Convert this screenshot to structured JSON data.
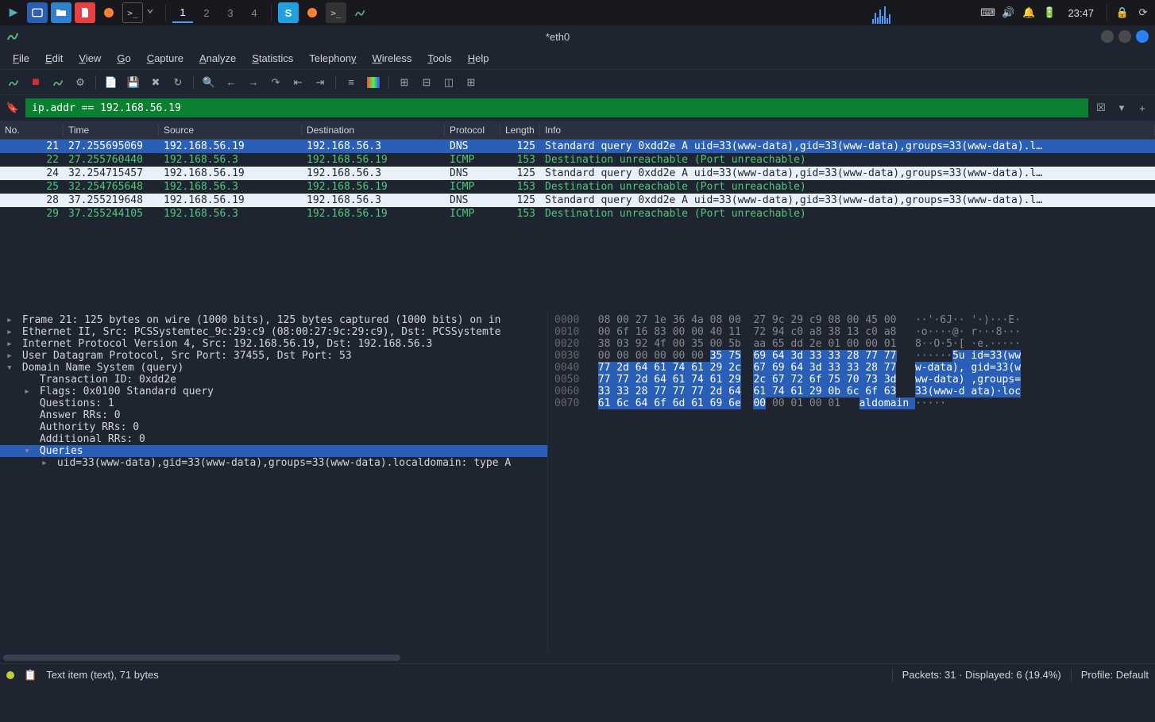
{
  "taskbar": {
    "workspaces": [
      "1",
      "2",
      "3",
      "4"
    ],
    "active_workspace": 0,
    "clock": "23:47"
  },
  "window": {
    "title": "*eth0"
  },
  "menubar": [
    "File",
    "Edit",
    "View",
    "Go",
    "Capture",
    "Analyze",
    "Statistics",
    "Telephony",
    "Wireless",
    "Tools",
    "Help"
  ],
  "filter": {
    "value": "ip.addr == 192.168.56.19"
  },
  "packet_columns": [
    "No.",
    "Time",
    "Source",
    "Destination",
    "Protocol",
    "Length",
    "Info"
  ],
  "packets": [
    {
      "no": "21",
      "time": "27.255695069",
      "src": "192.168.56.19",
      "dst": "192.168.56.3",
      "proto": "DNS",
      "len": "125",
      "info": "Standard query 0xdd2e A uid=33(www-data),gid=33(www-data),groups=33(www-data).l…",
      "cls": "selected"
    },
    {
      "no": "22",
      "time": "27.255760440",
      "src": "192.168.56.3",
      "dst": "192.168.56.19",
      "proto": "ICMP",
      "len": "153",
      "info": "Destination unreachable (Port unreachable)",
      "cls": "icmp"
    },
    {
      "no": "24",
      "time": "32.254715457",
      "src": "192.168.56.19",
      "dst": "192.168.56.3",
      "proto": "DNS",
      "len": "125",
      "info": "Standard query 0xdd2e A uid=33(www-data),gid=33(www-data),groups=33(www-data).l…",
      "cls": "dns"
    },
    {
      "no": "25",
      "time": "32.254765648",
      "src": "192.168.56.3",
      "dst": "192.168.56.19",
      "proto": "ICMP",
      "len": "153",
      "info": "Destination unreachable (Port unreachable)",
      "cls": "icmp"
    },
    {
      "no": "28",
      "time": "37.255219648",
      "src": "192.168.56.19",
      "dst": "192.168.56.3",
      "proto": "DNS",
      "len": "125",
      "info": "Standard query 0xdd2e A uid=33(www-data),gid=33(www-data),groups=33(www-data).l…",
      "cls": "dns"
    },
    {
      "no": "29",
      "time": "37.255244105",
      "src": "192.168.56.3",
      "dst": "192.168.56.19",
      "proto": "ICMP",
      "len": "153",
      "info": "Destination unreachable (Port unreachable)",
      "cls": "icmp"
    }
  ],
  "tree": [
    {
      "indent": 0,
      "expand": "▸",
      "text": "Frame 21: 125 bytes on wire (1000 bits), 125 bytes captured (1000 bits) on in"
    },
    {
      "indent": 0,
      "expand": "▸",
      "text": "Ethernet II, Src: PCSSystemtec_9c:29:c9 (08:00:27:9c:29:c9), Dst: PCSSystemte"
    },
    {
      "indent": 0,
      "expand": "▸",
      "text": "Internet Protocol Version 4, Src: 192.168.56.19, Dst: 192.168.56.3"
    },
    {
      "indent": 0,
      "expand": "▸",
      "text": "User Datagram Protocol, Src Port: 37455, Dst Port: 53"
    },
    {
      "indent": 0,
      "expand": "▾",
      "text": "Domain Name System (query)"
    },
    {
      "indent": 1,
      "expand": "",
      "text": "Transaction ID: 0xdd2e"
    },
    {
      "indent": 1,
      "expand": "▸",
      "text": "Flags: 0x0100 Standard query"
    },
    {
      "indent": 1,
      "expand": "",
      "text": "Questions: 1"
    },
    {
      "indent": 1,
      "expand": "",
      "text": "Answer RRs: 0"
    },
    {
      "indent": 1,
      "expand": "",
      "text": "Authority RRs: 0"
    },
    {
      "indent": 1,
      "expand": "",
      "text": "Additional RRs: 0"
    },
    {
      "indent": 1,
      "expand": "▾",
      "text": "Queries",
      "sel": true
    },
    {
      "indent": 2,
      "expand": "▸",
      "text": "uid=33(www-data),gid=33(www-data),groups=33(www-data).localdomain: type A"
    }
  ],
  "hex": [
    {
      "off": "0000",
      "b1": "08 00 27 1e 36 4a 08 00",
      "b2": "27 9c 29 c9 08 00 45 00",
      "asc": "··'·6J·· '·)···E·"
    },
    {
      "off": "0010",
      "b1": "00 6f 16 83 00 00 40 11",
      "b2": "72 94 c0 a8 38 13 c0 a8",
      "asc": "·o····@· r···8···"
    },
    {
      "off": "0020",
      "b1": "38 03 92 4f 00 35 00 5b",
      "b2": "aa 65 dd 2e 01 00 00 01",
      "asc": "8··O·5·[ ·e.·····"
    },
    {
      "off": "0030",
      "b1": "00 00 00 00 00 00 ",
      "b1s": "35 75",
      "b2s": "69 64 3d 33 33 28 77 77",
      "ascp": "······",
      "ascs": "5u id=33(ww"
    },
    {
      "off": "0040",
      "b1s": "77 2d 64 61 74 61 29 2c",
      "b2s": "67 69 64 3d 33 33 28 77",
      "ascs": "w-data), gid=33(w"
    },
    {
      "off": "0050",
      "b1s": "77 77 2d 64 61 74 61 29",
      "b2s": "2c 67 72 6f 75 70 73 3d",
      "ascs": "ww-data) ,groups="
    },
    {
      "off": "0060",
      "b1s": "33 33 28 77 77 77 2d 64",
      "b2s": "61 74 61 29 0b 6c 6f 63",
      "ascs": "33(www-d ata)·loc"
    },
    {
      "off": "0070",
      "b1s": "61 6c 64 6f 6d 61 69 6e",
      "b2p": "00",
      "b2": " 00 01 00 01",
      "ascs": "aldomain ",
      "ascp2": "·····"
    }
  ],
  "statusbar": {
    "left": "Text item (text), 71 bytes",
    "mid": "Packets: 31 · Displayed: 6 (19.4%)",
    "right": "Profile: Default"
  }
}
